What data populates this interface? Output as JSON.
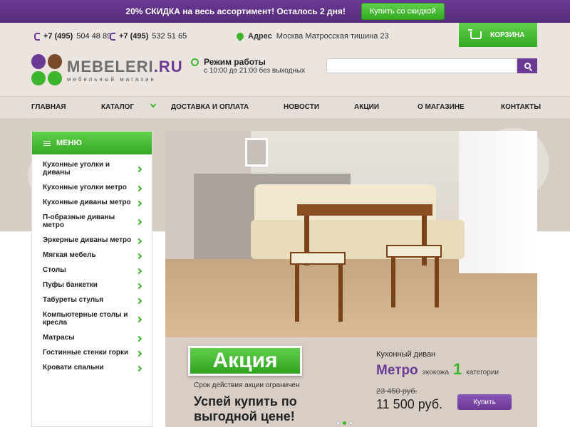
{
  "promo": {
    "text": "20% СКИДКА на весь ассортимент! Осталось 2 дня!",
    "button": "Купить со скидкой"
  },
  "header": {
    "phones": [
      {
        "prefix": "+7 (495)",
        "number": "504 48 89"
      },
      {
        "prefix": "+7 (495)",
        "number": "532 51 65"
      }
    ],
    "address_label": "Адрес",
    "address_value": "Москва Матросская тишина 23",
    "cart_label": "КОРЗИНА",
    "hours_title": "Режим работы",
    "hours_value": "с 10:00 до 21:00 без выходных",
    "search_placeholder": ""
  },
  "logo": {
    "name_main": "MEBELERI",
    "name_suffix": ".RU",
    "subtitle": "мебельный магазин",
    "colors": [
      "#6b3a94",
      "#7a4a2a",
      "#3cb52c",
      "#3cb52c"
    ]
  },
  "nav": {
    "items": [
      "Главная",
      "Каталог",
      "Доставка и оплата",
      "Новости",
      "Акции",
      "О магазине",
      "Контакты"
    ]
  },
  "menu": {
    "title": "МЕНЮ",
    "items": [
      "Кухонные уголки и диваны",
      "Кухонные уголки метро",
      "Кухонные диваны метро",
      "П-образные диваны метро",
      "Эркерные диваны метро",
      "Мягкая мебель",
      "Столы",
      "Пуфы банкетки",
      "Табуреты стулья",
      "Компьютерные столы и кресла",
      "Матрасы",
      "Гостинные стенки горки",
      "Кровати спальни"
    ]
  },
  "hero": {
    "badge": "Акция",
    "term": "Срок действия акции ограничен",
    "call": "Успей купить по выгодной цене!",
    "product_label": "Кухонный диван",
    "product_name": "Метро",
    "material": "экокожа",
    "category_num": "1",
    "category_label": "категории",
    "old_price": "23 450 руб.",
    "new_price": "11 500 руб.",
    "buy_button": "Купить",
    "active_slide": 2,
    "slide_count": 3
  },
  "colors": {
    "accent_purple": "#6b3a94",
    "accent_green": "#3cb52c"
  }
}
